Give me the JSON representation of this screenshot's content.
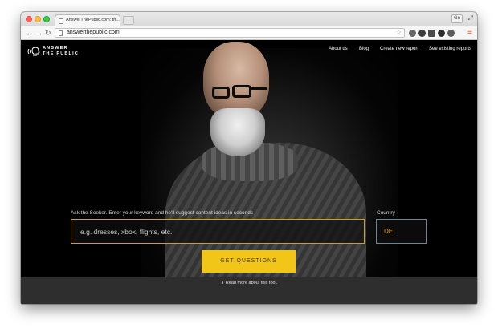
{
  "browser": {
    "tab_title": "AnswerThePublic.com: th...",
    "tab_close": "×",
    "profile_label": "Gn",
    "url": "answerthepublic.com"
  },
  "site": {
    "logo_line1": "ANSWER",
    "logo_line2": "THE PUBLIC",
    "nav": [
      "About us",
      "Blog",
      "Create new report",
      "See existing reports"
    ]
  },
  "search": {
    "prompt": "Ask the Seeker. Enter your keyword and he'll suggest content ideas in seconds",
    "placeholder": "e.g. dresses, xbox, flights, etc.",
    "value": ""
  },
  "country": {
    "label": "Country",
    "value": "DE"
  },
  "cta": {
    "label": "GET QUESTIONS"
  },
  "footer": {
    "read_more": "⬇ Read more about this tool."
  },
  "colors": {
    "accent": "#f2c519",
    "country_text": "#e6a817",
    "search_border": "#c9a227",
    "bottom_bar": "#2e2e2e"
  }
}
